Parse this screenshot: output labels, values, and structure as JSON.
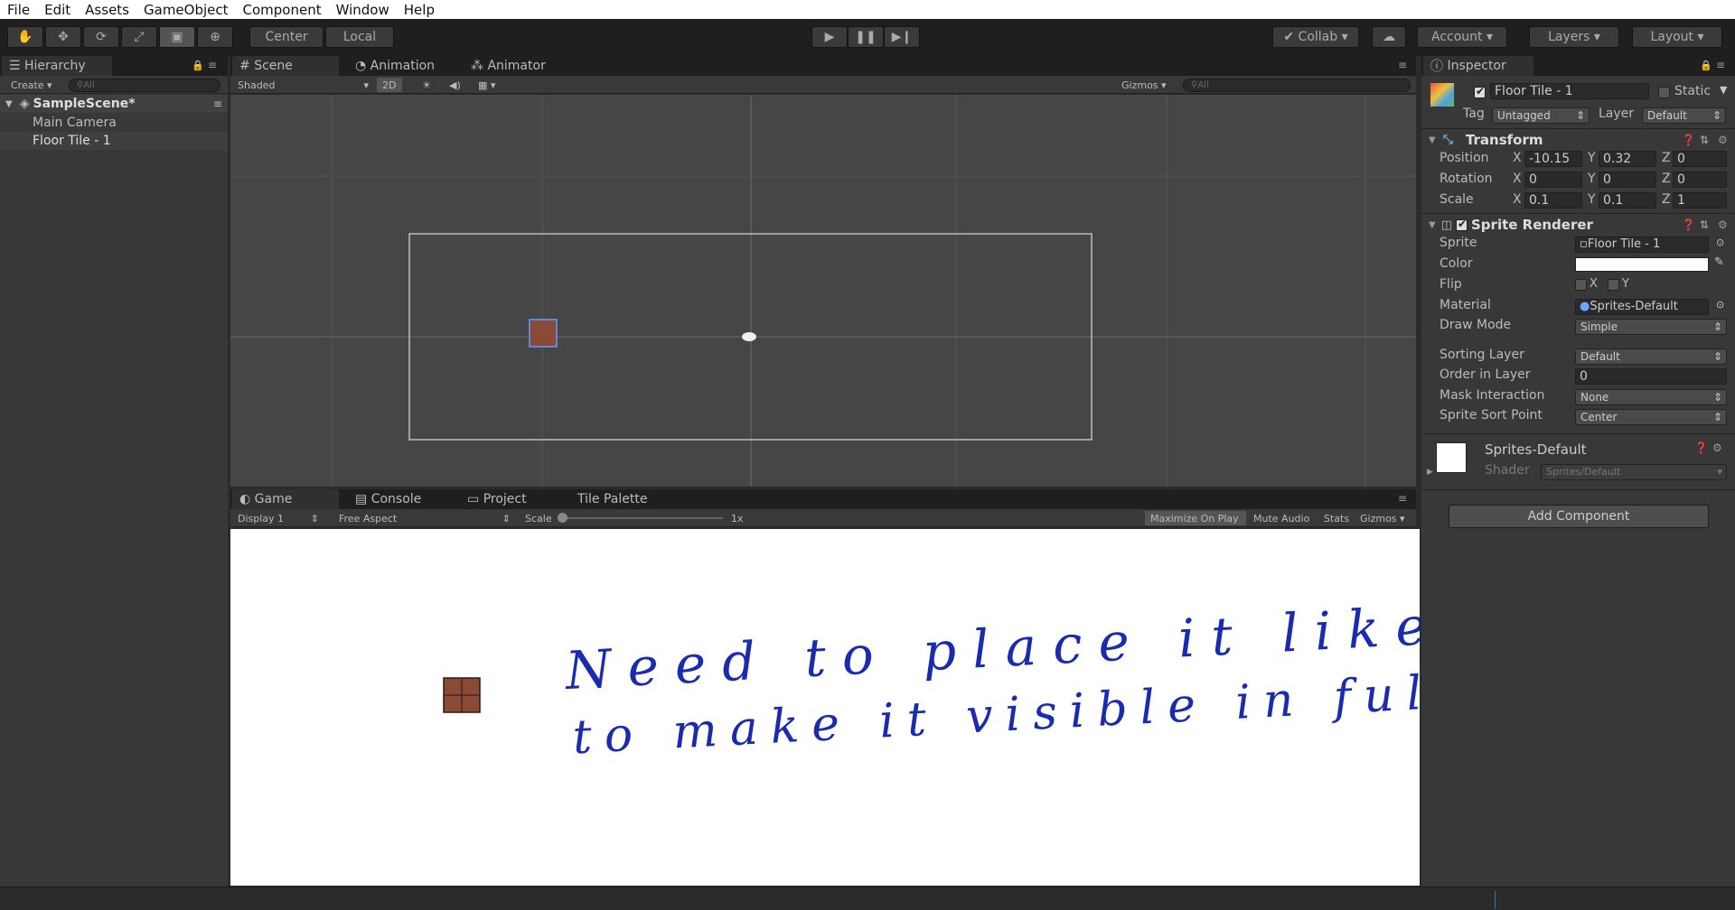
{
  "menu": [
    "File",
    "Edit",
    "Assets",
    "GameObject",
    "Component",
    "Window",
    "Help"
  ],
  "toolbar": {
    "tools": [
      "hand-icon",
      "move-icon",
      "rotate-icon",
      "scale-icon",
      "rect-icon",
      "transform-icon"
    ],
    "pivot_label": "Center",
    "space_label": "Local",
    "collab_label": "Collab",
    "account_label": "Account",
    "layers_label": "Layers",
    "layout_label": "Layout"
  },
  "hierarchy": {
    "tab": "Hierarchy",
    "create": "Create",
    "search_placeholder": "All",
    "scene": "SampleScene*",
    "items": [
      "Main Camera",
      "Floor Tile - 1"
    ]
  },
  "scene_view": {
    "tabs": [
      "Scene",
      "Animation",
      "Animator"
    ],
    "shading": "Shaded",
    "mode2d": "2D",
    "gizmos": "Gizmos",
    "search_placeholder": "All"
  },
  "game_view": {
    "tabs": [
      "Game",
      "Console",
      "Project",
      "Tile Palette"
    ],
    "display": "Display 1",
    "aspect": "Free Aspect",
    "scale_label": "Scale",
    "scale_value": "1x",
    "buttons": [
      "Maximize On Play",
      "Mute Audio",
      "Stats",
      "Gizmos"
    ],
    "annotation_line1": "Need to place it like this",
    "annotation_line2": "to make it visible in full screen"
  },
  "inspector": {
    "tab": "Inspector",
    "object_name": "Floor Tile - 1",
    "static_label": "Static",
    "tag_label": "Tag",
    "tag_value": "Untagged",
    "layer_label": "Layer",
    "layer_value": "Default",
    "transform": {
      "title": "Transform",
      "rows": [
        {
          "label": "Position",
          "x": "-10.15",
          "y": "0.32",
          "z": "0"
        },
        {
          "label": "Rotation",
          "x": "0",
          "y": "0",
          "z": "0"
        },
        {
          "label": "Scale",
          "x": "0.1",
          "y": "0.1",
          "z": "1"
        }
      ]
    },
    "sprite_renderer": {
      "title": "Sprite Renderer",
      "sprite_label": "Sprite",
      "sprite_value": "Floor Tile - 1",
      "color_label": "Color",
      "color_value": "#ffffff",
      "flip_label": "Flip",
      "flip_x": "X",
      "flip_y": "Y",
      "material_label": "Material",
      "material_value": "Sprites-Default",
      "draw_mode_label": "Draw Mode",
      "draw_mode_value": "Simple",
      "sorting_layer_label": "Sorting Layer",
      "sorting_layer_value": "Default",
      "order_label": "Order in Layer",
      "order_value": "0",
      "mask_label": "Mask Interaction",
      "mask_value": "None",
      "sort_point_label": "Sprite Sort Point",
      "sort_point_value": "Center"
    },
    "material": {
      "name": "Sprites-Default",
      "shader_label": "Shader",
      "shader_value": "Sprites/Default"
    },
    "add_component": "Add Component"
  },
  "colors": {
    "ink": "#1a2bb0",
    "tile": "#8b4a36"
  }
}
